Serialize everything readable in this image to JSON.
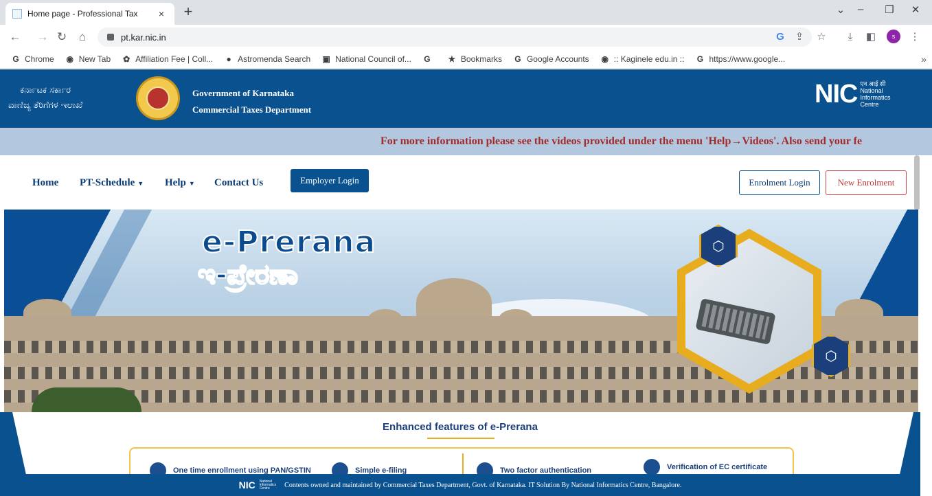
{
  "browser": {
    "tab_title": "Home page - Professional Tax",
    "tab_close": "×",
    "new_tab": "+",
    "url": "pt.kar.nic.in",
    "profile_initial": "s",
    "bookmarks": [
      {
        "icon": "G",
        "label": "Chrome"
      },
      {
        "icon": "◉",
        "label": "New Tab"
      },
      {
        "icon": "✿",
        "label": "Affiliation Fee | Coll..."
      },
      {
        "icon": "●",
        "label": "Astromenda Search"
      },
      {
        "icon": "▣",
        "label": "National Council of..."
      },
      {
        "icon": "G",
        "label": ""
      },
      {
        "icon": "★",
        "label": "Bookmarks"
      },
      {
        "icon": "G",
        "label": "Google Accounts"
      },
      {
        "icon": "◉",
        "label": ":: Kaginele edu.in ::"
      },
      {
        "icon": "G",
        "label": "https://www.google..."
      }
    ],
    "bookmarks_more": "»"
  },
  "header": {
    "kn_line1": "ಕರ್ನಾಟಕ ಸರ್ಕಾರ",
    "kn_line2": "ವಾಣಿಜ್ಯ ತೆರಿಗೆಗಳ ಇಲಾಖೆ",
    "en_line1": "Government of Karnataka",
    "en_line2": "Commercial Taxes Department",
    "nic_logo": "NIC",
    "nic_hindi": "एन आई सी",
    "nic_sub1": "National",
    "nic_sub2": "Informatics",
    "nic_sub3": "Centre"
  },
  "marquee": "For more information please see the videos provided under the menu 'Help→Videos'. Also send your fe",
  "nav": {
    "home": "Home",
    "pt_schedule": "PT-Schedule",
    "help": "Help",
    "contact": "Contact Us",
    "employer_login": "Employer Login",
    "enrolment_login": "Enrolment Login",
    "new_enrolment": "New Enrolment",
    "caret": "▼"
  },
  "banner": {
    "title_en": "e-Prerana",
    "title_kn": "ಇ-ಪ್ರೇರಣಾ"
  },
  "features": {
    "title": "Enhanced features of e-Prerana",
    "items": [
      "One time enrollment using PAN/GSTIN",
      "Simple e-filing",
      "Two factor authentication",
      "Verification of EC certificate"
    ]
  },
  "footer": {
    "logo": "NIC",
    "text": "Contents owned and maintained by Commercial Taxes Department, Govt. of Karnataka. IT Solution By National Informatics Centre, Bangalore."
  }
}
